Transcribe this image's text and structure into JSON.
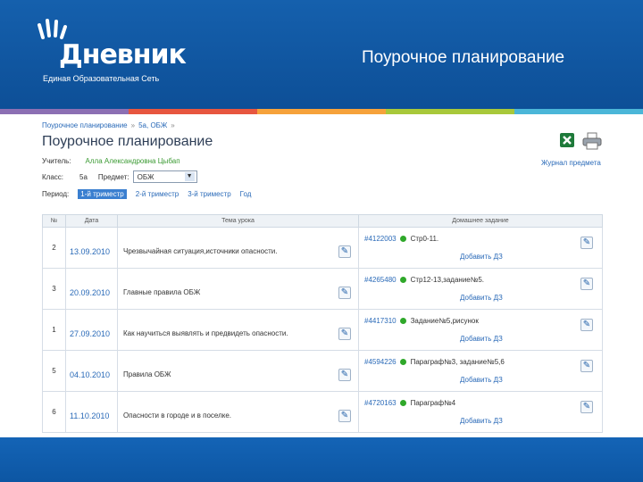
{
  "brand": {
    "name": "Дневник",
    "tagline": "Единая Образовательная Сеть"
  },
  "slide_title": "Поурочное планирование",
  "breadcrumb": [
    "Поурочное планирование",
    "5а, ОБЖ"
  ],
  "page_title": "Поурочное планирование",
  "teacher": {
    "label": "Учитель:",
    "name": "Алла Александровна Цыбап"
  },
  "class_field": {
    "label": "Класс:",
    "value": "5а"
  },
  "subject": {
    "label": "Предмет:",
    "selected": "ОБЖ"
  },
  "period": {
    "label": "Период:",
    "tabs": [
      "1-й триместр",
      "2-й триместр",
      "3-й триместр",
      "Год"
    ],
    "active_index": 0
  },
  "journal_link": "Журнал предмета",
  "table": {
    "headers": [
      "№",
      "Дата",
      "Тема урока",
      "Домашнее задание"
    ],
    "add_hw_label": "Добавить ДЗ",
    "rows": [
      {
        "num": "2",
        "date": "13.09.2010",
        "topic": "Чрезвычайная ситуация,источники опасности.",
        "hw_id": "#4122003",
        "hw_text": "Стр0-11."
      },
      {
        "num": "3",
        "date": "20.09.2010",
        "topic": "Главные правила ОБЖ",
        "hw_id": "#4265480",
        "hw_text": "Стр12-13,задание№5."
      },
      {
        "num": "1",
        "date": "27.09.2010",
        "topic": "Как научиться выявлять и предвидеть опасности.",
        "hw_id": "#4417310",
        "hw_text": "Задание№5,рисунок"
      },
      {
        "num": "5",
        "date": "04.10.2010",
        "topic": "Правила ОБЖ",
        "hw_id": "#4594226",
        "hw_text": "Параграф№3, задание№5,6"
      },
      {
        "num": "6",
        "date": "11.10.2010",
        "topic": "Опасности в городе и в поселке.",
        "hw_id": "#4720163",
        "hw_text": "Параграф№4"
      }
    ]
  },
  "colors": {
    "header_blue": "#1560ad",
    "stripe": [
      "#8c6fb3",
      "#e7563f",
      "#f6a23b",
      "#a8c83a",
      "#4bb6d8"
    ],
    "hw_dot": "#2fa82a"
  }
}
